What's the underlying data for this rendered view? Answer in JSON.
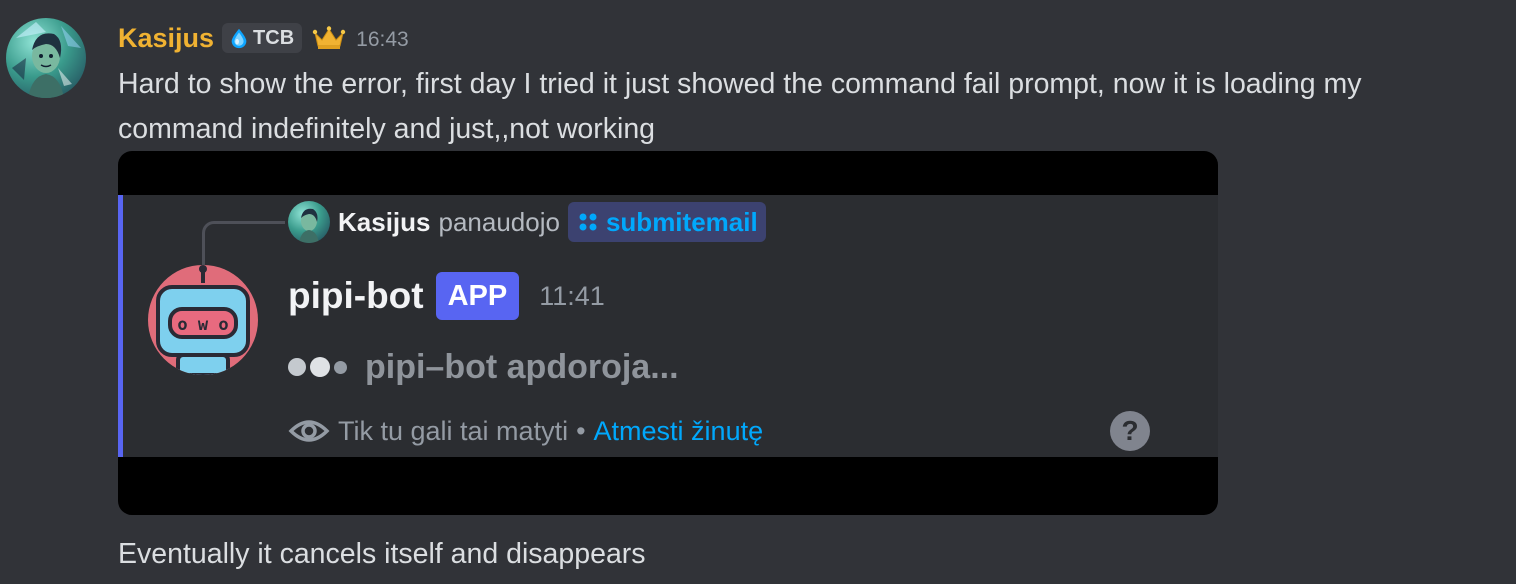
{
  "message": {
    "username": "Kasijus",
    "clan_tag": "TCB",
    "timestamp": "16:43",
    "content_lines": [
      "Hard to show the error, first day I tried it just showed the command fail prompt, now it is loading my",
      "command indefinitely and just,,not working"
    ],
    "footer": "Eventually it cancels itself and disappears",
    "icons": {
      "clan": "droplet-icon",
      "role": "crown-icon"
    },
    "colors": {
      "username": "#f0b232",
      "background": "#313338"
    }
  },
  "attachment": {
    "reply": {
      "user": "Kasijus",
      "verb": "panaudojo",
      "command": "submitemail"
    },
    "bot": {
      "name": "pipi-bot",
      "badge": "APP",
      "time": "11:41",
      "loading_text": "pipi–bot apdoroja..."
    },
    "ephemeral": {
      "notice": "Tik tu gali tai matyti",
      "separator": "•",
      "dismiss": "Atmesti žinutę"
    },
    "help_glyph": "?",
    "colors": {
      "accent": "#5865f2",
      "link": "#00a8fc"
    }
  }
}
